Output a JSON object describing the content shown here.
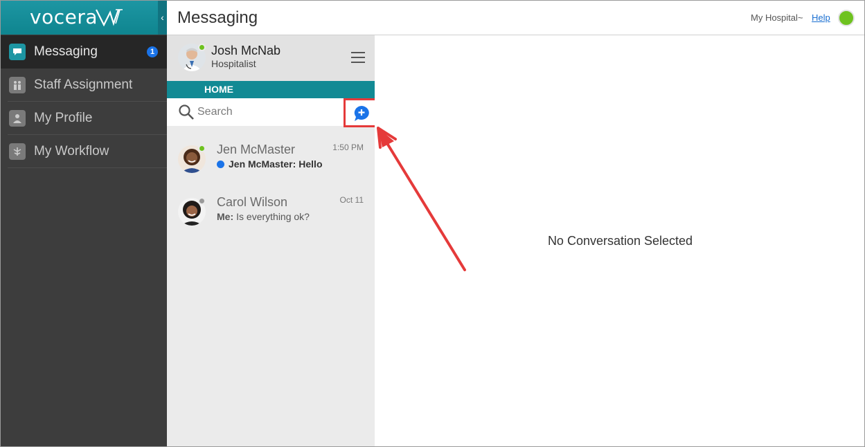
{
  "brand": {
    "logo_text": "vocera"
  },
  "nav": {
    "items": [
      {
        "label": "Messaging",
        "icon": "chat-icon",
        "badge": "1",
        "active": true
      },
      {
        "label": "Staff Assignment",
        "icon": "people-icon"
      },
      {
        "label": "My Profile",
        "icon": "person-icon"
      },
      {
        "label": "My Workflow",
        "icon": "workflow-icon"
      }
    ]
  },
  "header": {
    "title": "Messaging",
    "hospital": "My Hospital~",
    "help": "Help",
    "status_color": "#6ec21f"
  },
  "user": {
    "name": "Josh McNab",
    "role": "Hospitalist",
    "presence_color": "#6ec21f"
  },
  "panel": {
    "home_label": "HOME",
    "search_placeholder": "Search"
  },
  "conversations": [
    {
      "name": "Jen McMaster",
      "time": "1:50 PM",
      "sender": "Jen McMaster:",
      "message": "Hello",
      "unread": true,
      "presence_color": "#6ec21f"
    },
    {
      "name": "Carol Wilson",
      "time": "Oct 11",
      "sender": "Me:",
      "message": "Is everything ok?",
      "unread": false,
      "presence_color": "#9a9a9a"
    }
  ],
  "main": {
    "empty_text": "No Conversation Selected"
  },
  "colors": {
    "teal": "#128a94",
    "nav_bg": "#3d3d3d",
    "annotation_red": "#e53a3a",
    "accent_blue": "#1a73e8"
  }
}
